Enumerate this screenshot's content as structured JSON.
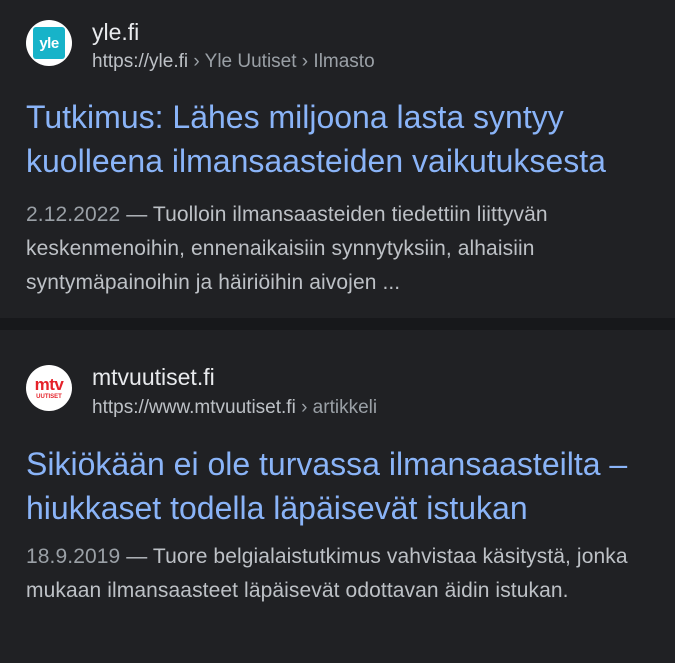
{
  "results": [
    {
      "site_name": "yle.fi",
      "url_base": "https://yle.fi",
      "url_crumbs": " › Yle Uutiset › Ilmasto",
      "favicon_icon": "yle-logo-icon",
      "favicon_text": "yle",
      "favicon_color": "#17b3c9",
      "title_line1": "Tutkimus: Lähes miljoona lasta syntyy",
      "title_line2": "kuolleena ilmansaasteiden vaikutuksesta",
      "date": "2.12.2022",
      "snippet": " — Tuolloin ilmansaasteiden tiedettiin liittyvän keskenmenoihin, ennenaikaisiin synnytyksiin, alhaisiin syntymäpainoihin ja häiriöihin aivojen ..."
    },
    {
      "site_name": "mtvuutiset.fi",
      "url_base": "https://www.mtvuutiset.fi",
      "url_crumbs": " › artikkeli",
      "favicon_icon": "mtv-logo-icon",
      "favicon_text": "mtv",
      "favicon_subtext": "UUTISET",
      "favicon_color": "#e5222a",
      "title_line1": "Sikiökään ei ole turvassa ilmansaasteilta –",
      "title_line2": "hiukkaset todella läpäisevät istukan",
      "date": "18.9.2019",
      "snippet": " — Tuore belgialaistutkimus vahvistaa käsitystä, jonka mukaan ilmansaasteet läpäisevät odottavan äidin istukan."
    }
  ],
  "colors": {
    "background": "#202124",
    "title_link": "#8ab4f8",
    "text": "#bdc1c6"
  }
}
